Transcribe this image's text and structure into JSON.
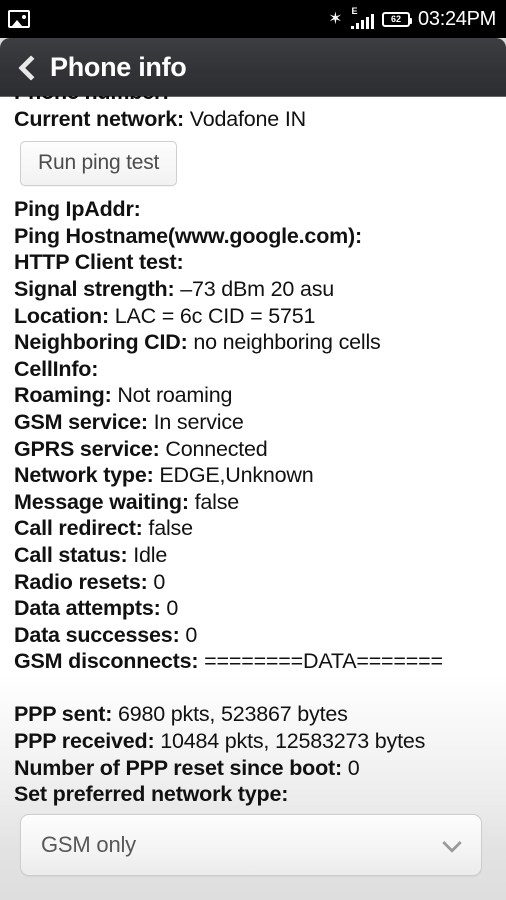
{
  "statusbar": {
    "notification_icon": "photo-icon",
    "bluetooth_icon": "bluetooth-icon",
    "bluetooth_glyph": "✶",
    "network_type_tag": "E",
    "signal_icon": "signal-bars-icon",
    "battery_icon": "battery-icon",
    "battery_level": "62",
    "clock": "03:24PM"
  },
  "titlebar": {
    "back_icon": "back-chevron-icon",
    "title": "Phone info"
  },
  "button": {
    "run_ping_test": "Run ping test"
  },
  "info_lines": [
    {
      "label": "Phone number:",
      "value": ""
    },
    {
      "label": "Current network:",
      "value": "Vodafone IN"
    }
  ],
  "info_lines_2": [
    {
      "label": "Ping IpAddr:",
      "value": ""
    },
    {
      "label": "Ping Hostname(www.google.com):",
      "value": ""
    },
    {
      "label": "HTTP Client test:",
      "value": ""
    },
    {
      "label": "Signal strength:",
      "value": "–73 dBm   20 asu"
    },
    {
      "label": "Location:",
      "value": "LAC = 6c   CID = 5751"
    },
    {
      "label": "Neighboring CID:",
      "value": "no neighboring cells"
    },
    {
      "label": "CellInfo:",
      "value": ""
    },
    {
      "label": "Roaming:",
      "value": "Not roaming"
    },
    {
      "label": "GSM service:",
      "value": "In service"
    },
    {
      "label": "GPRS service:",
      "value": "Connected"
    },
    {
      "label": "Network type:",
      "value": "EDGE,Unknown"
    },
    {
      "label": "Message waiting:",
      "value": "false"
    },
    {
      "label": "Call redirect:",
      "value": "false"
    },
    {
      "label": "Call status:",
      "value": "Idle"
    },
    {
      "label": "Radio resets:",
      "value": "0"
    },
    {
      "label": "Data attempts:",
      "value": "0"
    },
    {
      "label": "Data successes:",
      "value": "0"
    },
    {
      "label": "GSM disconnects:",
      "value": "========DATA======="
    }
  ],
  "info_lines_3": [
    {
      "label": "PPP sent:",
      "value": "6980 pkts, 523867 bytes"
    },
    {
      "label": "PPP received:",
      "value": "10484 pkts, 12583273 bytes"
    },
    {
      "label": "Number of PPP reset since boot:",
      "value": "0"
    },
    {
      "label": "Set preferred network type:",
      "value": ""
    }
  ],
  "network_type_select": {
    "selected": "GSM only",
    "chevron_icon": "chevron-down-icon"
  },
  "colors": {
    "statusbar_bg": "#000000",
    "titlebar_bg": "#313336",
    "content_bg": "#ffffff",
    "page_bg": "#dedede",
    "text": "#111111"
  }
}
